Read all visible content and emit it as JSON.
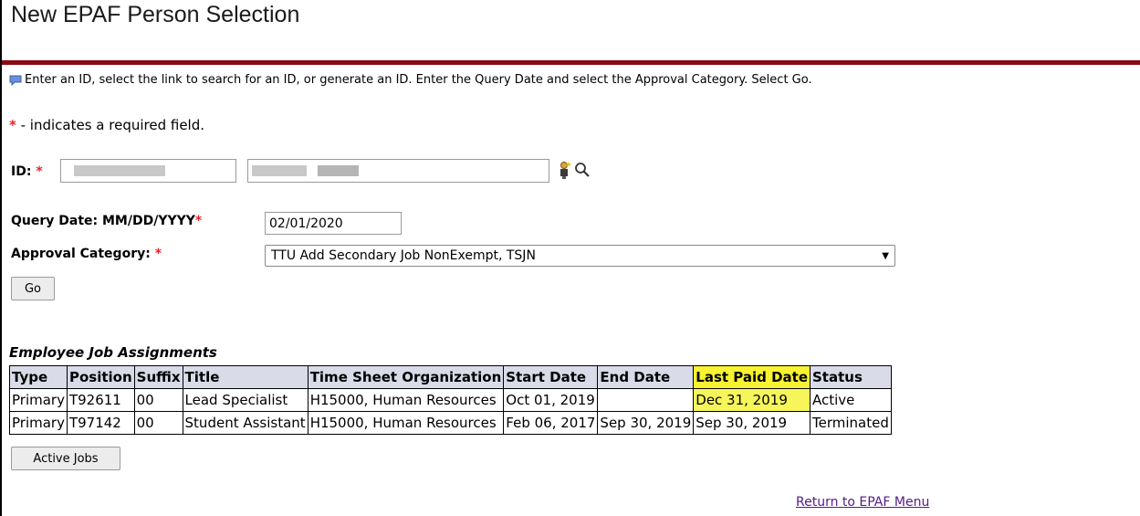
{
  "header": {
    "title": "New EPAF Person Selection"
  },
  "info": {
    "instruction": "Enter an ID, select the link to search for an ID, or generate an ID. Enter the Query Date and select the Approval Category. Select Go.",
    "required_note": " - indicates a required field.",
    "required_star": "*"
  },
  "form": {
    "id_label": "ID:",
    "query_date_label": "Query Date: MM/DD/YYYY",
    "query_date_value": "02/01/2020",
    "approval_category_label": "Approval Category:",
    "approval_category_value": "TTU Add Secondary Job NonExempt, TSJN",
    "go_label": "Go"
  },
  "icons": {
    "info": "speech-bubble-icon",
    "generate_id": "person-generate-icon",
    "search": "magnifier-icon"
  },
  "jobs": {
    "section_title": "Employee Job Assignments",
    "columns": [
      "Type",
      "Position",
      "Suffix",
      "Title",
      "Time Sheet Organization",
      "Start Date",
      "End Date",
      "Last Paid Date",
      "Status"
    ],
    "rows": [
      [
        "Primary",
        "T92611",
        "00",
        "Lead Specialist",
        "H15000, Human Resources",
        "Oct 01, 2019",
        "",
        "Dec 31, 2019",
        "Active"
      ],
      [
        "Primary",
        "T97142",
        "00",
        "Student Assistant",
        "H15000, Human Resources",
        "Feb 06, 2017",
        "Sep 30, 2019",
        "Sep 30, 2019",
        "Terminated"
      ]
    ],
    "active_jobs_label": "Active Jobs"
  },
  "footer": {
    "return_link": "Return to EPAF Menu"
  },
  "colors": {
    "title_rule": "#8b0a14",
    "required_star": "#e8232a",
    "header_bg": "#d9dbe8",
    "highlight": "#f8f332",
    "link": "#551a8b"
  }
}
